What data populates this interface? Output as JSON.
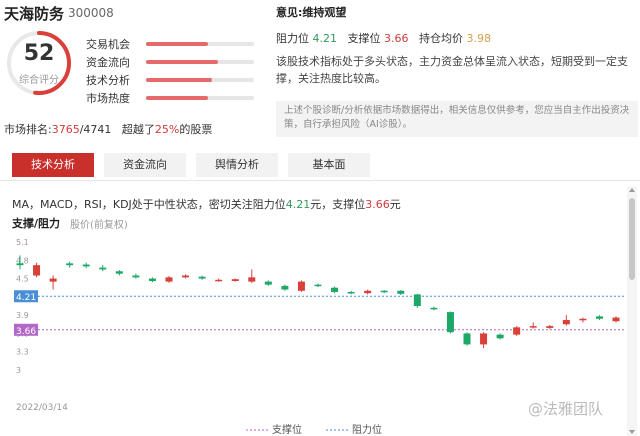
{
  "stock": {
    "name": "天海防务",
    "code": "300008"
  },
  "score": {
    "value": "52",
    "label": "综合评分",
    "fraction": 0.52
  },
  "metrics": [
    {
      "label": "交易机会",
      "fill": 0.57
    },
    {
      "label": "资金流向",
      "fill": 0.67
    },
    {
      "label": "技术分析",
      "fill": 0.61
    },
    {
      "label": "市场热度",
      "fill": 0.57
    }
  ],
  "rank": {
    "prefix": "市场排名:",
    "rank": "3765",
    "total": "/4741",
    "middle": "超越了",
    "percent": "25%",
    "suffix": "的股票"
  },
  "opinion": {
    "label": "意见:",
    "value": "维持观望"
  },
  "levels": {
    "resistance_label": "阻力位",
    "resistance": "4.21",
    "support_label": "支撑位",
    "support": "3.66",
    "cost_label": "持仓均价",
    "cost": "3.98"
  },
  "description": "该股技术指标处于多头状态，主力资金总体呈流入状态，短期受到一定支撑，关注热度比较高。",
  "disclaimer": "上述个股诊断/分析依据市场数据得出，相关信息仅供参考，您应当自主作出投资决策，自行承担风险（AI诊股）。",
  "tabs": [
    "技术分析",
    "资金流向",
    "舆情分析",
    "基本面"
  ],
  "summary": {
    "pre": "MA，MACD，RSI，KDJ处于中性状态，密切关注阻力位",
    "res": "4.21",
    "mid": "元，支撑位",
    "sup": "3.66",
    "post": "元"
  },
  "chart_title": "支撑/阻力",
  "chart_subtitle": "股价(前复权)",
  "watermark": "@法雅团队",
  "colors": {
    "up": "#d9403a",
    "down": "#1ea867",
    "support": "#b268c7",
    "resistance": "#4a8fd6"
  },
  "chart_data": {
    "type": "candlestick",
    "ylim": [
      3.0,
      5.1
    ],
    "yticks": [
      "5.1",
      "4.8",
      "4.5",
      "4.2",
      "3.9",
      "3.6",
      "3.3",
      "3"
    ],
    "x_start_label": "2022/03/14",
    "support": 3.66,
    "resistance": 4.21,
    "support_label": "3.66",
    "resistance_label": "4.21",
    "legend": [
      "支撑位",
      "阻力位"
    ],
    "candles": [
      {
        "o": 4.75,
        "c": 4.72,
        "h": 4.88,
        "l": 4.65
      },
      {
        "o": 4.55,
        "c": 4.72,
        "h": 4.76,
        "l": 4.52
      },
      {
        "o": 4.45,
        "c": 4.5,
        "h": 4.55,
        "l": 4.32
      },
      {
        "o": 4.75,
        "c": 4.72,
        "h": 4.78,
        "l": 4.68
      },
      {
        "o": 4.73,
        "c": 4.7,
        "h": 4.76,
        "l": 4.67
      },
      {
        "o": 4.68,
        "c": 4.65,
        "h": 4.72,
        "l": 4.62
      },
      {
        "o": 4.62,
        "c": 4.58,
        "h": 4.64,
        "l": 4.55
      },
      {
        "o": 4.55,
        "c": 4.52,
        "h": 4.58,
        "l": 4.5
      },
      {
        "o": 4.5,
        "c": 4.46,
        "h": 4.52,
        "l": 4.44
      },
      {
        "o": 4.45,
        "c": 4.52,
        "h": 4.54,
        "l": 4.43
      },
      {
        "o": 4.52,
        "c": 4.55,
        "h": 4.57,
        "l": 4.5
      },
      {
        "o": 4.53,
        "c": 4.5,
        "h": 4.55,
        "l": 4.48
      },
      {
        "o": 4.46,
        "c": 4.48,
        "h": 4.5,
        "l": 4.45
      },
      {
        "o": 4.46,
        "c": 4.49,
        "h": 4.5,
        "l": 4.45
      },
      {
        "o": 4.45,
        "c": 4.52,
        "h": 4.65,
        "l": 4.43
      },
      {
        "o": 4.45,
        "c": 4.4,
        "h": 4.47,
        "l": 4.38
      },
      {
        "o": 4.38,
        "c": 4.32,
        "h": 4.4,
        "l": 4.3
      },
      {
        "o": 4.3,
        "c": 4.45,
        "h": 4.47,
        "l": 4.28
      },
      {
        "o": 4.4,
        "c": 4.38,
        "h": 4.42,
        "l": 4.36
      },
      {
        "o": 4.35,
        "c": 4.28,
        "h": 4.37,
        "l": 4.26
      },
      {
        "o": 4.28,
        "c": 4.26,
        "h": 4.3,
        "l": 4.24
      },
      {
        "o": 4.26,
        "c": 4.3,
        "h": 4.32,
        "l": 4.24
      },
      {
        "o": 4.3,
        "c": 4.28,
        "h": 4.31,
        "l": 4.26
      },
      {
        "o": 4.3,
        "c": 4.25,
        "h": 4.31,
        "l": 4.23
      },
      {
        "o": 4.24,
        "c": 4.05,
        "h": 4.25,
        "l": 4.02
      },
      {
        "o": 4.02,
        "c": 4.0,
        "h": 4.04,
        "l": 3.98
      },
      {
        "o": 3.95,
        "c": 3.62,
        "h": 3.96,
        "l": 3.6
      },
      {
        "o": 3.6,
        "c": 3.42,
        "h": 3.62,
        "l": 3.4
      },
      {
        "o": 3.42,
        "c": 3.6,
        "h": 3.62,
        "l": 3.36
      },
      {
        "o": 3.58,
        "c": 3.52,
        "h": 3.6,
        "l": 3.5
      },
      {
        "o": 3.58,
        "c": 3.7,
        "h": 3.72,
        "l": 3.56
      },
      {
        "o": 3.7,
        "c": 3.72,
        "h": 3.78,
        "l": 3.68
      },
      {
        "o": 3.69,
        "c": 3.72,
        "h": 3.74,
        "l": 3.67
      },
      {
        "o": 3.75,
        "c": 3.82,
        "h": 3.9,
        "l": 3.73
      },
      {
        "o": 3.82,
        "c": 3.84,
        "h": 3.86,
        "l": 3.78
      },
      {
        "o": 3.88,
        "c": 3.84,
        "h": 3.9,
        "l": 3.82
      },
      {
        "o": 3.8,
        "c": 3.86,
        "h": 3.88,
        "l": 3.78
      }
    ]
  }
}
